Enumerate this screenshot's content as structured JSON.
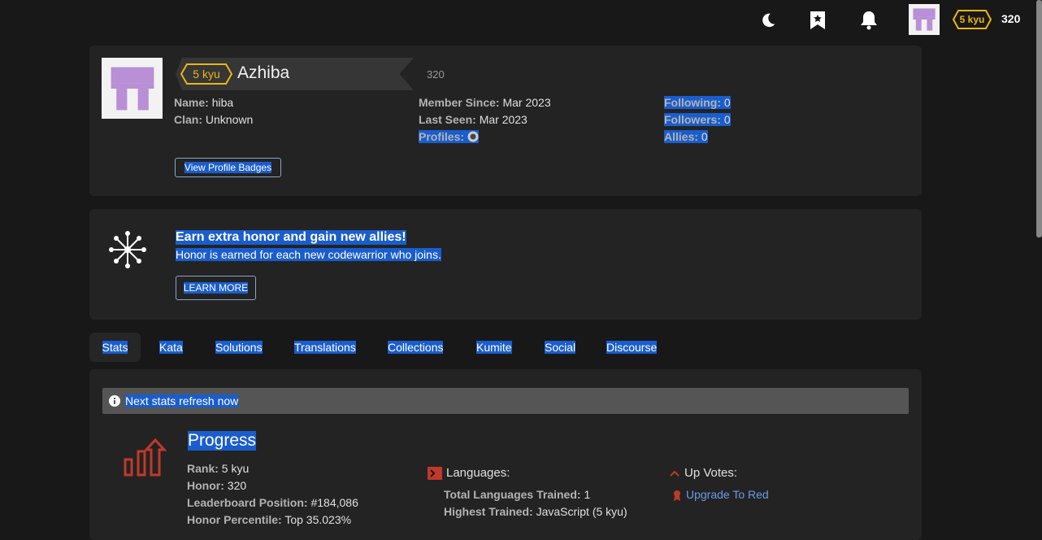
{
  "topbar": {
    "icons": [
      "moon-icon",
      "bookmark-icon",
      "bell-icon"
    ],
    "rank": "5 kyu",
    "honor": "320"
  },
  "profile": {
    "rank": "5 kyu",
    "username": "Azhiba",
    "honor": "320",
    "name_label": "Name:",
    "name_value": "hiba",
    "clan_label": "Clan:",
    "clan_value": "Unknown",
    "member_since_label": "Member Since:",
    "member_since_value": "Mar 2023",
    "last_seen_label": "Last Seen:",
    "last_seen_value": "Mar 2023",
    "profiles_label": "Profiles:",
    "following_label": "Following:",
    "following_value": "0",
    "followers_label": "Followers:",
    "followers_value": "0",
    "allies_label": "Allies:",
    "allies_value": "0",
    "badges_button": "View Profile Badges"
  },
  "promo": {
    "title": "Earn extra honor and gain new allies!",
    "subtitle": "Honor is earned for each new codewarrior who joins.",
    "button": "LEARN MORE"
  },
  "tabs": [
    "Stats",
    "Kata",
    "Solutions",
    "Translations",
    "Collections",
    "Kumite",
    "Social",
    "Discourse"
  ],
  "stats": {
    "notice": "Next stats refresh now",
    "progress_title": "Progress",
    "rank_label": "Rank:",
    "rank_value": "5 kyu",
    "honor_label": "Honor:",
    "honor_value": "320",
    "leaderboard_label": "Leaderboard Position:",
    "leaderboard_value": "#184,086",
    "percentile_label": "Honor Percentile:",
    "percentile_value": "Top 35.023%",
    "languages_heading": "Languages:",
    "total_lang_label": "Total Languages Trained:",
    "total_lang_value": "1",
    "highest_label": "Highest Trained:",
    "highest_value": "JavaScript (5 kyu)",
    "upvotes_heading": "Up Votes:",
    "upgrade_link": "Upgrade To Red"
  },
  "colors": {
    "accent_rank": "#ecb613",
    "selection": "#1a5dcc",
    "progress_icon": "#c0392b",
    "avatar": "#b98fd6"
  }
}
